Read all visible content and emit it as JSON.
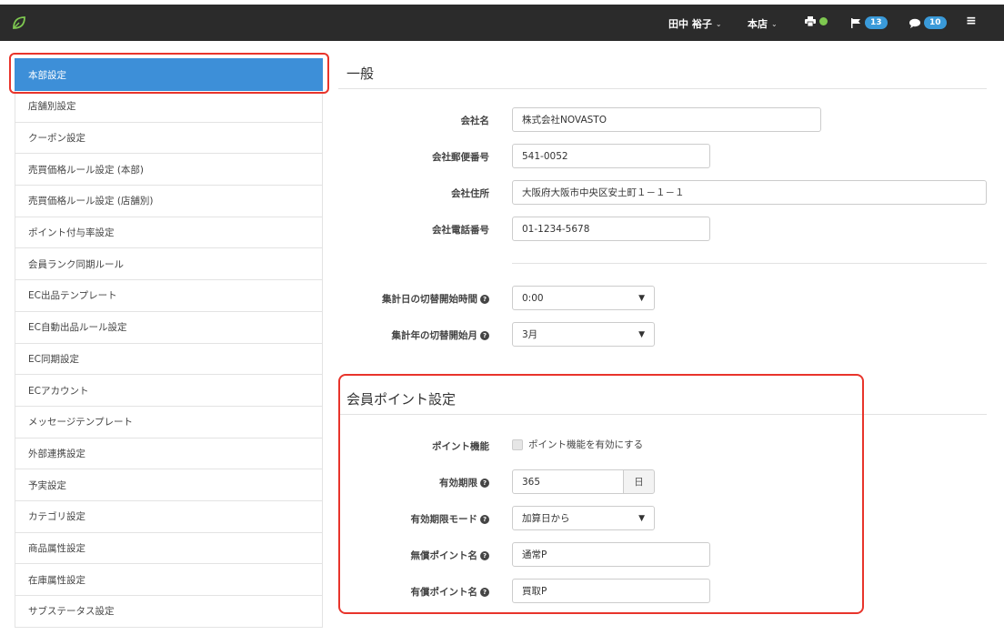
{
  "topbar": {
    "user_name": "田中 裕子",
    "store": "本店",
    "flag_count": "13",
    "message_count": "10",
    "colors": {
      "bg": "#2b2b2b",
      "badge": "#3a9ad9",
      "status": "#7ec850"
    }
  },
  "sidebar": {
    "items": [
      {
        "label": "本部設定",
        "active": true
      },
      {
        "label": "店舗別設定"
      },
      {
        "label": "クーポン設定"
      },
      {
        "label": "売買価格ルール設定 (本部)"
      },
      {
        "label": "売買価格ルール設定 (店舗別)"
      },
      {
        "label": "ポイント付与率設定"
      },
      {
        "label": "会員ランク同期ルール"
      },
      {
        "label": "EC出品テンプレート"
      },
      {
        "label": "EC自動出品ルール設定"
      },
      {
        "label": "EC同期設定"
      },
      {
        "label": "ECアカウント"
      },
      {
        "label": "メッセージテンプレート"
      },
      {
        "label": "外部連携設定"
      },
      {
        "label": "予実設定"
      },
      {
        "label": "カテゴリ設定"
      },
      {
        "label": "商品属性設定"
      },
      {
        "label": "在庫属性設定"
      },
      {
        "label": "サブステータス設定"
      }
    ]
  },
  "general": {
    "title": "一般",
    "company_name_label": "会社名",
    "company_name": "株式会社NOVASTO",
    "zip_label": "会社郵便番号",
    "zip": "541-0052",
    "address_label": "会社住所",
    "address": "大阪府大阪市中央区安土町１－１－１",
    "phone_label": "会社電話番号",
    "phone": "01-1234-5678",
    "day_switch_label": "集計日の切替開始時間",
    "day_switch_value": "0:00",
    "year_switch_label": "集計年の切替開始月",
    "year_switch_value": "3月"
  },
  "points": {
    "title": "会員ポイント設定",
    "feature_label": "ポイント機能",
    "feature_checkbox": "ポイント機能を有効にする",
    "expiry_label": "有効期限",
    "expiry_value": "365",
    "expiry_unit": "日",
    "expiry_mode_label": "有効期限モード",
    "expiry_mode_value": "加算日から",
    "free_name_label": "無償ポイント名",
    "free_name_value": "通常P",
    "paid_name_label": "有償ポイント名",
    "paid_name_value": "買取P"
  }
}
